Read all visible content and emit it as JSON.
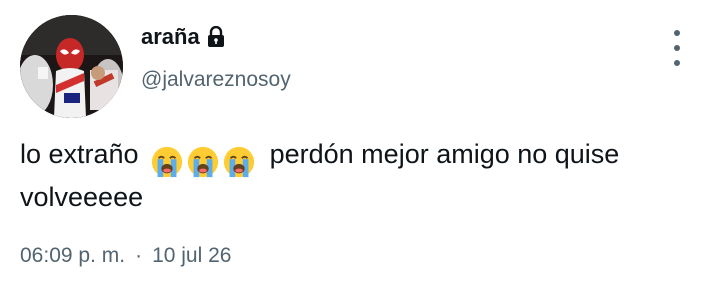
{
  "author": {
    "display_name": "araña",
    "handle": "@jalvareznosoy",
    "protected_icon": "lock-icon",
    "avatar_icon": "avatar-photo"
  },
  "tweet": {
    "text_before_emoji": "lo extraño",
    "emojis": [
      "loudly-crying-face",
      "loudly-crying-face",
      "loudly-crying-face"
    ],
    "text_after_emoji": "perdón mejor amigo no quise",
    "text_line2": "volveeeee"
  },
  "meta": {
    "time": "06:09 p. m.",
    "separator": "·",
    "date": "10 jul 26"
  },
  "menu": {
    "icon": "more-vertical-icon"
  },
  "colors": {
    "text_primary": "#0f1419",
    "text_secondary": "#536471",
    "background": "#ffffff",
    "emoji_yellow": "#ffcc33",
    "emoji_tears": "#5dadec"
  }
}
